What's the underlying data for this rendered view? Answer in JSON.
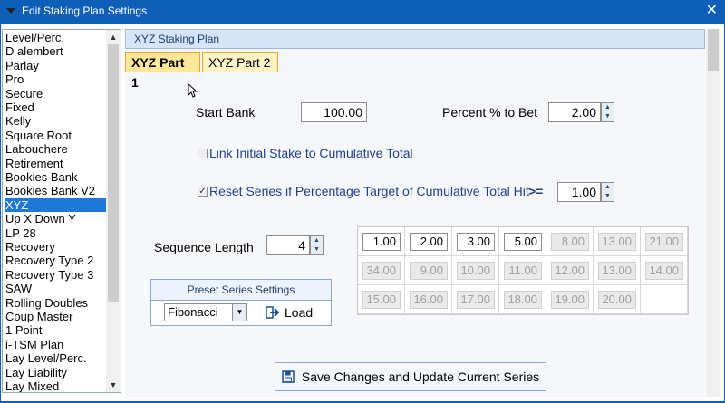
{
  "window": {
    "title": "Edit Staking Plan Settings",
    "close_label": "✕"
  },
  "plans": {
    "items": [
      "Level/Perc.",
      "D alembert",
      "Parlay",
      "Pro",
      "Secure",
      "Fixed",
      "Kelly",
      "Square Root",
      "Labouchere",
      "Retirement",
      "Bookies Bank",
      "Bookies Bank V2",
      "XYZ",
      "Up X Down Y",
      "LP 28",
      "Recovery",
      "Recovery Type 2",
      "Recovery Type 3",
      "SAW",
      "Rolling Doubles",
      "Coup Master",
      "1 Point",
      "i-TSM Plan",
      "Lay Level/Perc.",
      "Lay Liability",
      "Lay Mixed"
    ],
    "selected": "XYZ"
  },
  "panel": {
    "header": "XYZ Staking Plan",
    "tabs": [
      {
        "label": "XYZ Part 1",
        "active": true
      },
      {
        "label": "XYZ Part 2",
        "active": false
      }
    ]
  },
  "form": {
    "start_bank_label": "Start Bank",
    "start_bank_value": "100.00",
    "percent_label": "Percent % to Bet",
    "percent_value": "2.00",
    "link_initial_label": "Link Initial Stake to Cumulative Total",
    "link_initial_checked": false,
    "reset_series_label": "Reset Series if Percentage Target of Cumulative Total Hit",
    "reset_series_op": ">=",
    "reset_series_checked": true,
    "reset_series_value": "1.00",
    "sequence_length_label": "Sequence Length",
    "sequence_length_value": "4"
  },
  "sequence": [
    {
      "v": "1.00",
      "on": true
    },
    {
      "v": "2.00",
      "on": true
    },
    {
      "v": "3.00",
      "on": true
    },
    {
      "v": "5.00",
      "on": true
    },
    {
      "v": "8.00",
      "on": false
    },
    {
      "v": "13.00",
      "on": false
    },
    {
      "v": "21.00",
      "on": false
    },
    {
      "v": "34.00",
      "on": false
    },
    {
      "v": "9.00",
      "on": false
    },
    {
      "v": "10.00",
      "on": false
    },
    {
      "v": "11.00",
      "on": false
    },
    {
      "v": "12.00",
      "on": false
    },
    {
      "v": "13.00",
      "on": false
    },
    {
      "v": "14.00",
      "on": false
    },
    {
      "v": "15.00",
      "on": false
    },
    {
      "v": "16.00",
      "on": false
    },
    {
      "v": "17.00",
      "on": false
    },
    {
      "v": "18.00",
      "on": false
    },
    {
      "v": "19.00",
      "on": false
    },
    {
      "v": "20.00",
      "on": false
    }
  ],
  "preset": {
    "title": "Preset Series Settings",
    "selected": "Fibonacci",
    "load_label": "Load"
  },
  "save_label": "Save Changes and Update Current Series",
  "colors": {
    "titlebar": "#0f5fb8",
    "selection": "#1e78d7",
    "tab_active": "#ffe79a"
  },
  "icons": {
    "close": "close-icon",
    "load": "load-arrow-icon",
    "save": "floppy-disk-icon"
  }
}
